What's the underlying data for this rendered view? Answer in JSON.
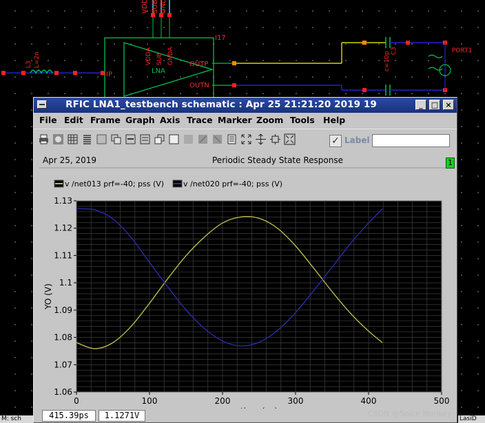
{
  "schematic": {
    "pins_top": [
      "VDDA",
      "SUB",
      "GNDA"
    ],
    "instance_name": "I17",
    "block_pins": [
      "VDDA",
      "SUB",
      "GNDA"
    ],
    "block_name": "LNA",
    "in_pin": "IP",
    "out_pins": [
      "OUTP",
      "OUTN"
    ],
    "inductor": "L3",
    "inductor_value": "L=2n",
    "capacitor": "C3",
    "capacitor_value": "c=10p",
    "port": "PORT1"
  },
  "window": {
    "title": "RFIC LNA1_testbench schematic : Apr 25 21:21:20 2019 19",
    "menu": [
      "File",
      "Edit",
      "Frame",
      "Graph",
      "Axis",
      "Trace",
      "Marker",
      "Zoom",
      "Tools",
      "Help"
    ],
    "toolbar_icons": [
      "print-icon",
      "camera-icon",
      "grid-icon",
      "strips-icon",
      "strip-icon",
      "add-subwindow-icon",
      "delete-subwindow-icon",
      "duplicate-icon",
      "copy-icon",
      "clear-icon",
      "cursor-icon",
      "marker-icon",
      "delete-marker-icon",
      "fit-icon",
      "zoom-x-icon",
      "zoom-y-icon",
      "zoom-fit-icon"
    ],
    "label_toggle": "Label",
    "label_checked": true,
    "label_value": "",
    "controls": {
      "minimize": "_",
      "maximize": "□",
      "close": "×"
    }
  },
  "graph": {
    "date": "Apr 25, 2019",
    "title": "Periodic Steady State Response",
    "status": "1",
    "status_color": "#14d21a",
    "background": "#000000",
    "grid_color": "#4a4a4a"
  },
  "readout": {
    "x": "415.39ps",
    "y": "1.1271V"
  },
  "chart_data": {
    "type": "line",
    "xlabel": "time (ps)",
    "ylabel": "YO (V)",
    "xlim": [
      0,
      500
    ],
    "ylim": [
      1.06,
      1.13
    ],
    "xticks": [
      0,
      100,
      200,
      300,
      400,
      500
    ],
    "yticks": [
      1.06,
      1.07,
      1.08,
      1.09,
      1.1,
      1.11,
      1.12,
      1.13
    ],
    "grid": true,
    "legend_position": "top-left",
    "series": [
      {
        "name": "v /net013 prf=-40; pss (V)",
        "color": "#b8b850",
        "x": [
          0,
          25,
          50,
          75,
          100,
          125,
          150,
          175,
          200,
          225,
          250,
          275,
          300,
          325,
          350,
          375,
          400,
          419
        ],
        "y": [
          1.0781,
          1.0759,
          1.0781,
          1.0841,
          1.0925,
          1.1015,
          1.1099,
          1.1167,
          1.1219,
          1.1241,
          1.1236,
          1.12,
          1.1135,
          1.1053,
          1.0968,
          1.0889,
          1.0823,
          1.0781
        ]
      },
      {
        "name": "v /net020 prf=-40; pss (V)",
        "color": "#2a2aa8",
        "x": [
          0,
          25,
          50,
          75,
          100,
          125,
          150,
          175,
          200,
          225,
          250,
          275,
          300,
          325,
          350,
          375,
          400,
          419
        ],
        "y": [
          1.1271,
          1.1267,
          1.1234,
          1.1165,
          1.1075,
          1.0985,
          1.0901,
          1.0833,
          1.0787,
          1.0769,
          1.0782,
          1.0825,
          1.0891,
          1.0972,
          1.1057,
          1.1143,
          1.1219,
          1.1271
        ]
      }
    ]
  },
  "watermark": "CSDN @Spice Monkey",
  "taskbar": {
    "left": "M: sch",
    "right": "LasiD"
  }
}
